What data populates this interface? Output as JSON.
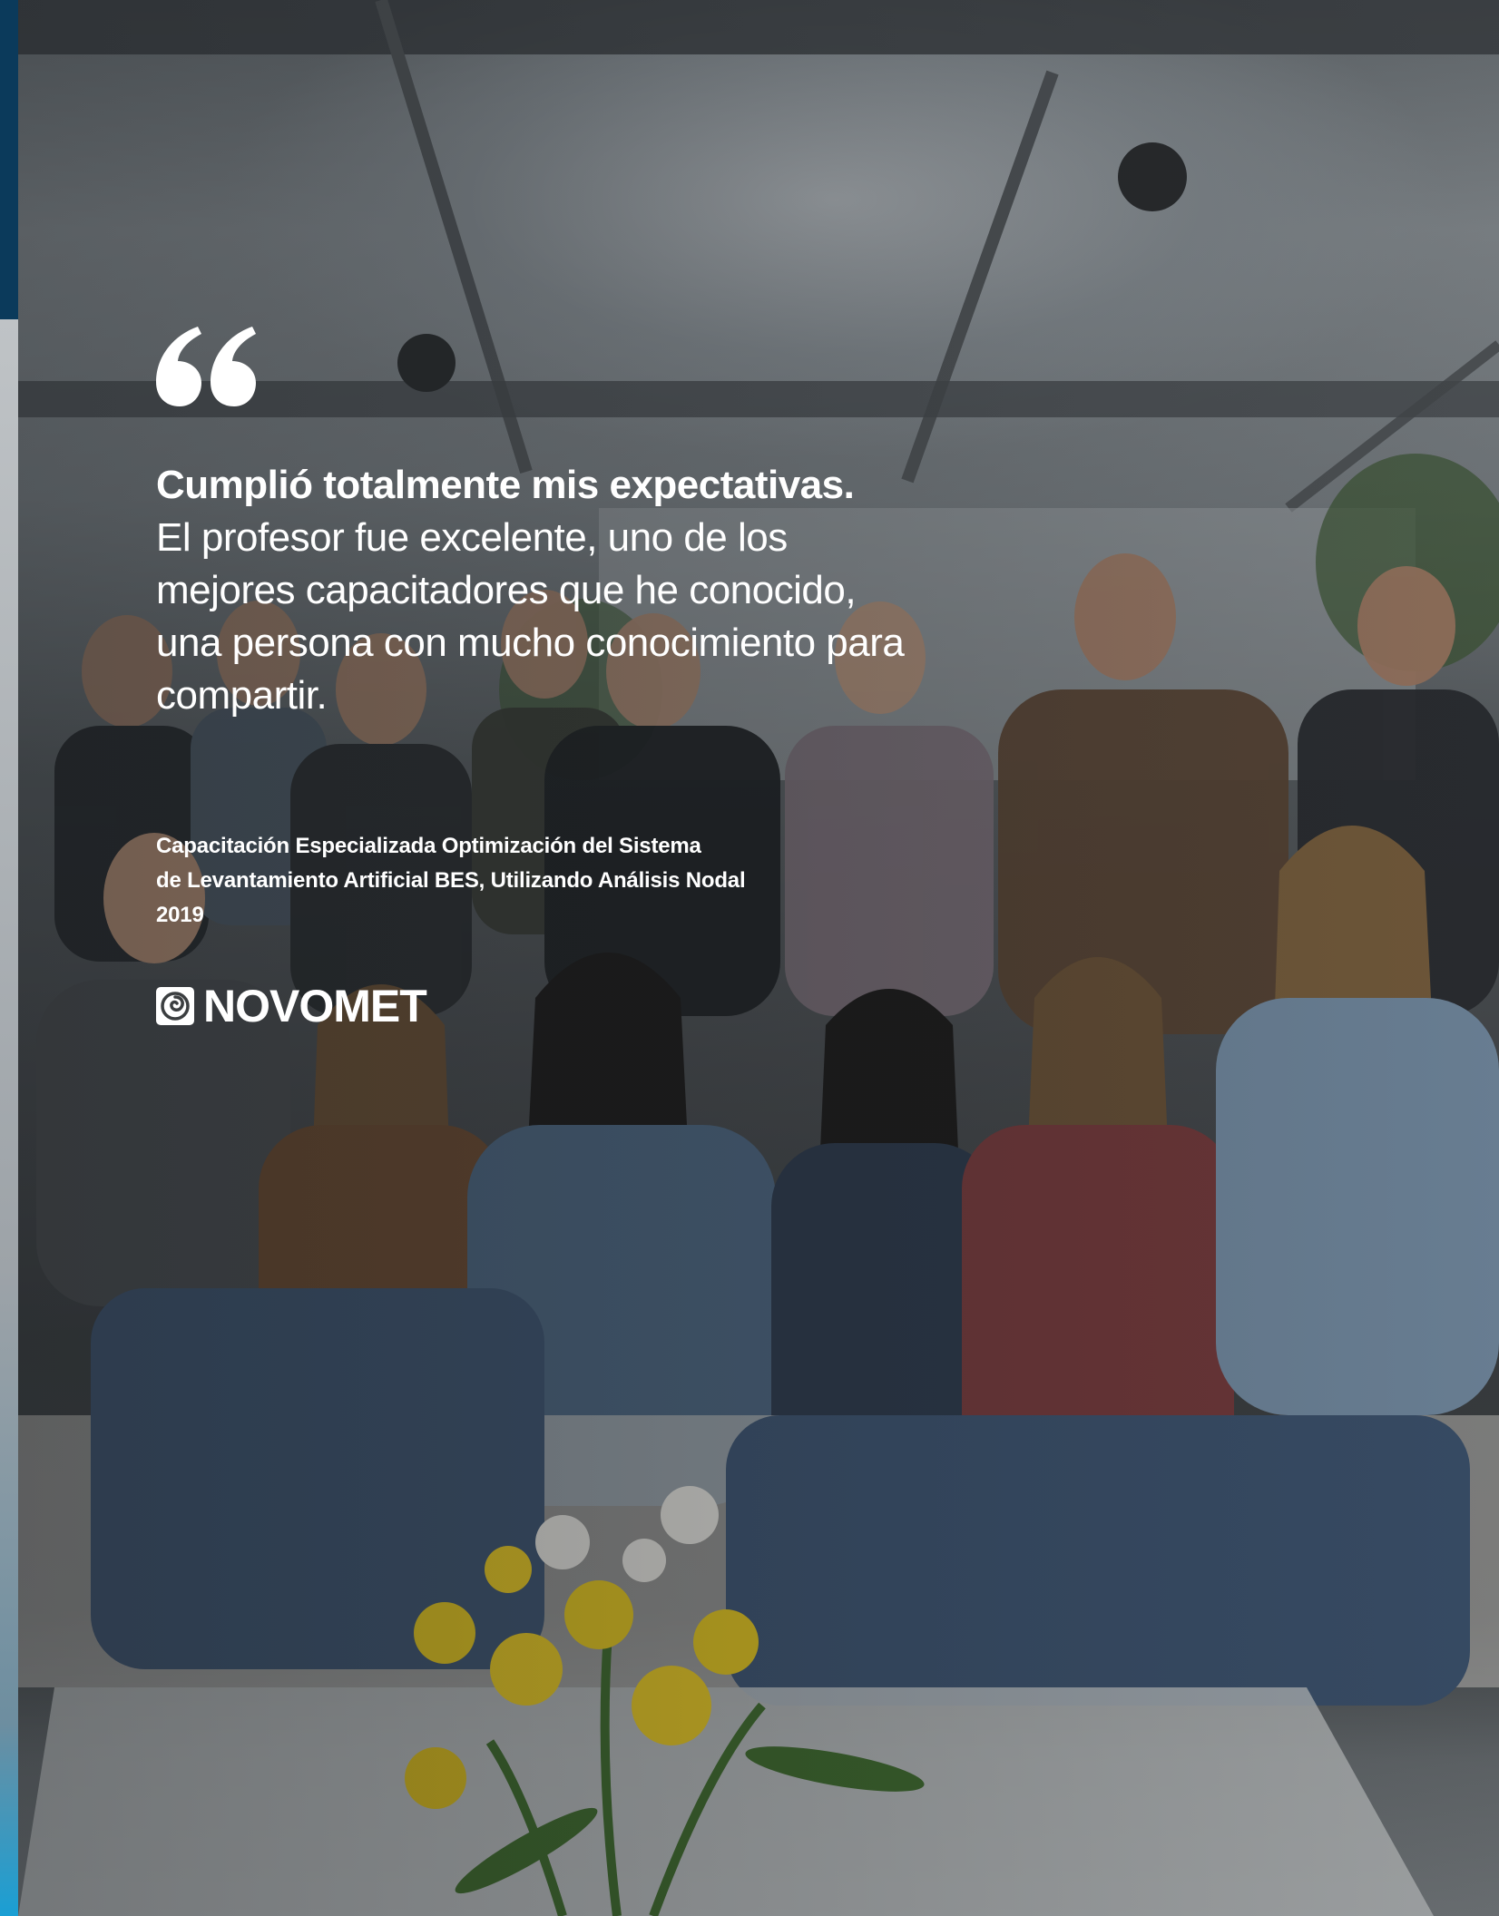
{
  "quote": {
    "headline": "Cumplió totalmente mis expectativas.",
    "body": "El profesor fue excelente, uno de los mejores capacitadores que he conocido, una persona con mucho conocimiento para compartir."
  },
  "caption": {
    "line1": "Capacitación Especializada Optimización del Sistema",
    "line2": "de Levantamiento Artificial BES, Utilizando Análisis Nodal",
    "year": "2019"
  },
  "brand": {
    "name": "NOVOMET",
    "logo_icon": "novomet-swirl-logo-icon"
  },
  "colors": {
    "text": "#ffffff",
    "strip_top": "#0b3a5b",
    "strip_bottom": "#1a9fd4"
  }
}
